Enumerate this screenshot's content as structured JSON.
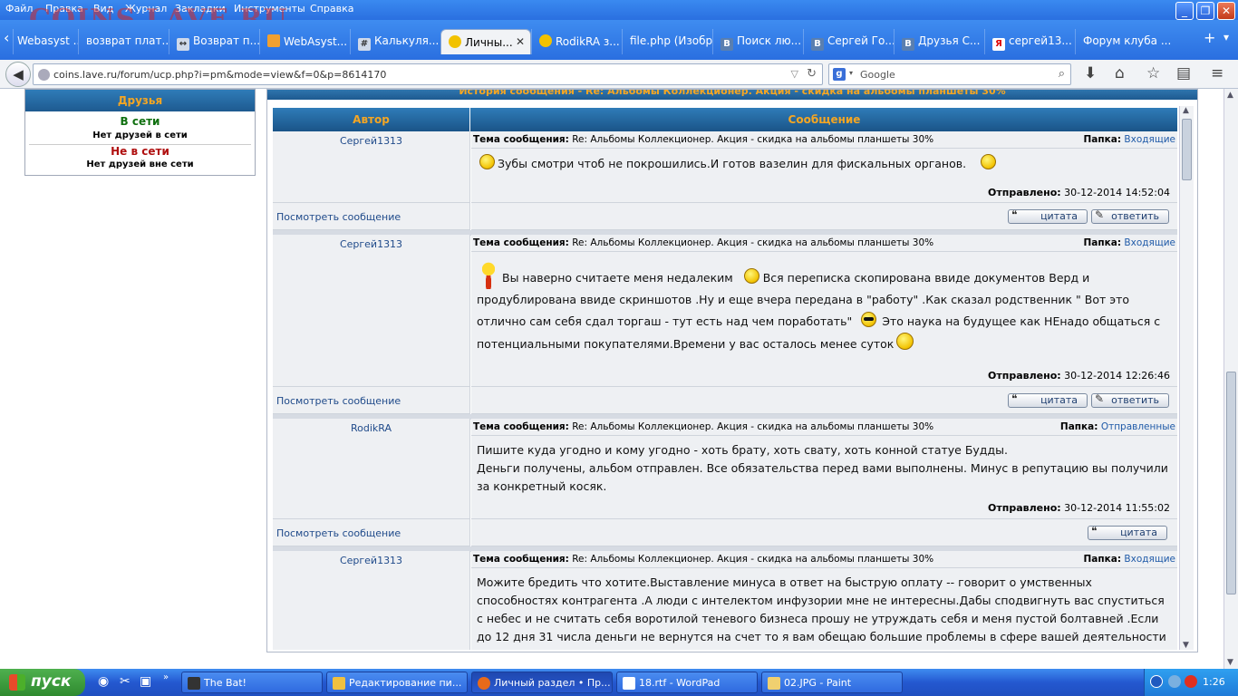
{
  "browser": {
    "menu": [
      "Файл",
      "Правка",
      "Вид",
      "Журнал",
      "Закладки",
      "Инструменты",
      "Справка"
    ],
    "watermark": "COINS.LAVE.RU",
    "window_buttons": {
      "minimize": "_",
      "restore": "❐",
      "close": "✕"
    },
    "tabs": [
      {
        "label": "Webasyst ...",
        "icon": "generic-icon"
      },
      {
        "label": "возврат плат...",
        "icon": "generic-icon"
      },
      {
        "label": "Возврат п...",
        "icon": "arrows-icon"
      },
      {
        "label": "WebAsyst...",
        "icon": "webasyst-icon"
      },
      {
        "label": "Калькуля...",
        "icon": "calculator-icon"
      },
      {
        "label": "Личны...",
        "icon": "smiley-icon",
        "active": true
      },
      {
        "label": "RodikRA з...",
        "icon": "smiley-icon"
      },
      {
        "label": "file.php (Изобр...",
        "icon": "generic-icon"
      },
      {
        "label": "Поиск лю...",
        "icon": "vk-icon"
      },
      {
        "label": "Сергей Го...",
        "icon": "vk-icon"
      },
      {
        "label": "Друзья С...",
        "icon": "vk-icon"
      },
      {
        "label": "сергей13...",
        "icon": "yandex-icon"
      },
      {
        "label": "Форум клуба ...",
        "icon": "generic-icon"
      }
    ],
    "tab_close": "✕",
    "tab_prev": "‹",
    "tab_new": "+",
    "tab_list": "▾",
    "url": "coins.lave.ru/forum/ucp.php?i=pm&mode=view&f=0&p=8614170",
    "search_placeholder": "Google",
    "search_engine_letter": "g"
  },
  "sidebar": {
    "title": "Друзья",
    "online_label": "В сети",
    "online_empty": "Нет друзей в сети",
    "offline_label": "Не в сети",
    "offline_empty": "Нет друзей вне сети"
  },
  "history": {
    "title": "История сообщения - Re: Альбомы Коллекционер. Акция - скидка на альбомы планшеты 30%",
    "col_author": "Автор",
    "col_message": "Сообщение",
    "topic_label": "Тема сообщения:",
    "folder_label": "Папка:",
    "sent_label": "Отправлено:",
    "view_link": "Посмотреть сообщение",
    "quote_btn": "цитата",
    "reply_btn": "ответить",
    "messages": [
      {
        "author": "Сергей1313",
        "topic": "Re: Альбомы Коллекционер. Акция - скидка на альбомы планшеты 30%",
        "folder": "Входящие",
        "text": "Зубы смотри чтоб не покрошились.И готов вазелин для фискальных органов.",
        "sent": "30-12-2014 14:52:04"
      },
      {
        "author": "Сергей1313",
        "topic": "Re: Альбомы Коллекционер. Акция - скидка на альбомы планшеты 30%",
        "folder": "Входящие",
        "text_parts": [
          "Вы наверно считаете меня недалеким",
          "Вся переписка скопирована ввиде документов Верд и продублирована ввиде скриншотов .Ну и еще вчера передана в \"работу\" .Как сказал родственник \" Вот это отлично сам себя сдал торгаш - тут есть над чем поработать\"",
          "Это наука на будущее как НЕнадо общаться с потенциальными покупателями.Времени у вас осталось менее суток"
        ],
        "sent": "30-12-2014 12:26:46"
      },
      {
        "author": "RodikRA",
        "topic": "Re: Альбомы Коллекционер. Акция - скидка на альбомы планшеты 30%",
        "folder": "Отправленные",
        "text_lines": [
          "Пишите куда угодно и кому угодно - хоть брату, хоть свату, хоть конной статуе Будды.",
          "Деньги получены, альбом отправлен. Все обязательства перед вами выполнены. Минус в репутацию вы получили за конкретный косяк."
        ],
        "sent": "30-12-2014 11:55:02"
      },
      {
        "author": "Сергей1313",
        "topic": "Re: Альбомы Коллекционер. Акция - скидка на альбомы планшеты 30%",
        "folder": "Входящие",
        "text": "Можите бредить что хотите.Выставление минуса в ответ на быструю оплату -- говорит о умственных способностях контрагента .А люди с интелектом инфузории мне не интересны.Дабы сподвигнуть вас спуститься с небес и не считать себя воротилой теневого бизнеса прошу не утруждать себя и меня пустой болтавней .Если до 12 дня 31 числа деньги не вернутся на счет то я вам обещаю большие проблемы в сфере вашей деятельности -- хочу"
      }
    ]
  },
  "taskbar": {
    "start": "пуск",
    "tasks": [
      {
        "label": "The Bat!",
        "icon": "bat-icon"
      },
      {
        "label": "Редактирование пи...",
        "icon": "edit-icon"
      },
      {
        "label": "Личный раздел • Пр...",
        "icon": "firefox-icon",
        "active": true
      },
      {
        "label": "18.rtf - WordPad",
        "icon": "wordpad-icon"
      },
      {
        "label": "02.JPG - Paint",
        "icon": "paint-icon"
      }
    ],
    "clock": "1:26"
  },
  "colors": {
    "accent_blue": "#2a6fe0",
    "header_orange": "#f5a623",
    "link_blue": "#1f4a8a",
    "online_green": "#107010",
    "offline_red": "#b01010"
  }
}
